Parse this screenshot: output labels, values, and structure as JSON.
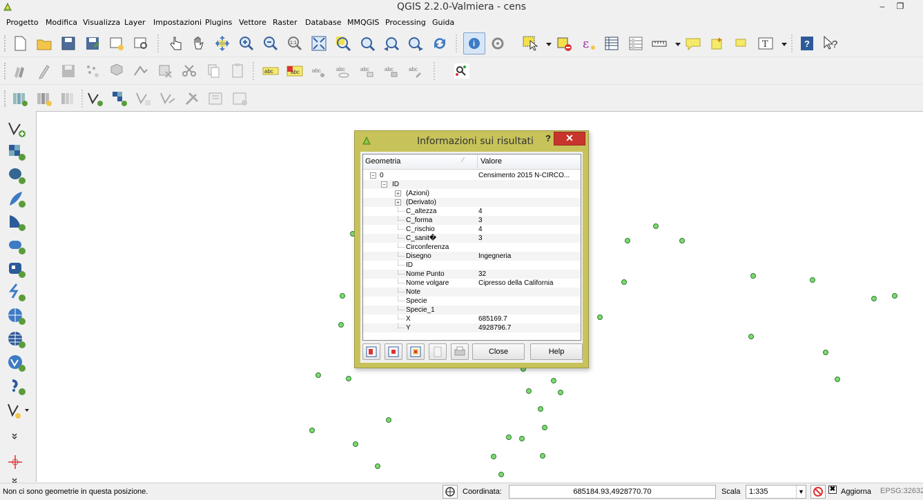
{
  "window": {
    "title": "QGIS 2.2.0-Valmiera - cens",
    "minimize": "‒",
    "restore": "❐"
  },
  "menu": [
    "Progetto",
    "Modifica",
    "Visualizza",
    "Layer",
    "Impostazioni",
    "Plugins",
    "Vettore",
    "Raster",
    "Database",
    "MMQGIS",
    "Processing",
    "Guida"
  ],
  "toolbar1_icons": [
    "new-project",
    "open-project",
    "save-project",
    "save-as",
    "new-print-composer",
    "composer-manager",
    "touch-zoom",
    "pan",
    "pan-to-selection",
    "zoom-in",
    "zoom-out",
    "zoom-native",
    "zoom-full",
    "zoom-to-selection",
    "zoom-to-layer",
    "zoom-last",
    "zoom-next",
    "refresh",
    "identify",
    "action",
    "select",
    "deselect",
    "field-calculator",
    "attribute-table",
    "statistics",
    "measure",
    "map-tips",
    "new-bookmark",
    "show-bookmarks",
    "text-annotation",
    "help",
    "whats-this"
  ],
  "toolbar2_icons": [
    "current-edits",
    "toggle-editing",
    "save-edits",
    "add-feature",
    "move-feature",
    "node-tool",
    "delete-selected",
    "cut-features",
    "copy-features",
    "paste-features",
    "label-tool",
    "layer-labeling",
    "pin-labels",
    "show-hide-labels",
    "move-label",
    "rotate-label",
    "change-label",
    "georeferencer"
  ],
  "toolbar3_icons": [
    "add-vector",
    "new-shapefile",
    "new-spatialite",
    "add-wms",
    "add-wcs",
    "add-wfs",
    "new-layer",
    "new-temp",
    "merge-layers",
    "raster-calc",
    "processing"
  ],
  "left_toolbar_icons": [
    "add-vector-layer",
    "add-raster-layer",
    "add-postgis-layer",
    "add-spatialite-layer",
    "add-mssql-layer",
    "add-oracle-layer",
    "add-db2-layer",
    "add-delimited-text",
    "add-wms-layer",
    "add-wcs-layer",
    "add-wfs-layer",
    "add-gpx-layer",
    "new-vector-layer",
    "more",
    "north-arrow",
    "more"
  ],
  "dialog": {
    "title": "Informazioni sui risultati",
    "help_q": "?",
    "close_x": "✕",
    "col_geometry": "Geometria",
    "col_value": "Valore",
    "rows": [
      {
        "k": "0",
        "v": "Censimento 2015 N-CIRCO..."
      },
      {
        "k": "ID",
        "v": ""
      },
      {
        "k": "(Azioni)",
        "v": ""
      },
      {
        "k": "(Derivato)",
        "v": ""
      },
      {
        "k": "C_altezza",
        "v": "4"
      },
      {
        "k": "C_forma",
        "v": "3"
      },
      {
        "k": "C_rischio",
        "v": "4"
      },
      {
        "k": "C_sanit�",
        "v": "3"
      },
      {
        "k": "Circonferenza",
        "v": ""
      },
      {
        "k": "Disegno",
        "v": "Ingegneria"
      },
      {
        "k": "ID",
        "v": ""
      },
      {
        "k": "Nome Punto",
        "v": "32"
      },
      {
        "k": "Nome volgare",
        "v": "Cipresso della California"
      },
      {
        "k": "Note",
        "v": ""
      },
      {
        "k": "Specie",
        "v": ""
      },
      {
        "k": "Specie_1",
        "v": ""
      },
      {
        "k": "X",
        "v": "685169.7"
      },
      {
        "k": "Y",
        "v": "4928796.7"
      }
    ],
    "btn_close": "Close",
    "btn_help": "Help"
  },
  "status": {
    "message": "Non ci sono geometrie in questa posizione.",
    "coord_label": "Coordinata:",
    "coord_value": "685184.93,4928770.70",
    "scale_label": "Scala",
    "scale_value": "1:335",
    "refresh_label": "Aggiorna",
    "crs": "EPSG:32632"
  },
  "colors": {
    "point_fill": "#7ed96f",
    "point_stroke": "#2e7d32",
    "dialog_frame": "#c7c35a",
    "close_red": "#c7352c"
  }
}
